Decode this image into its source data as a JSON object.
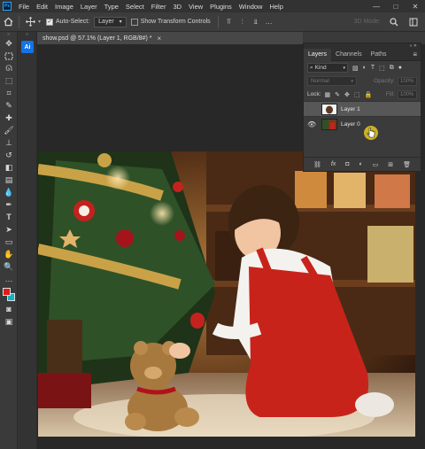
{
  "menubar": {
    "app_badge": "Ps",
    "items": [
      "File",
      "Edit",
      "Image",
      "Layer",
      "Type",
      "Select",
      "Filter",
      "3D",
      "View",
      "Plugins",
      "Window",
      "Help"
    ],
    "window_controls": [
      "—",
      "□",
      "✕"
    ]
  },
  "options": {
    "home_icon": "home-icon",
    "move_icon": "move-tool-icon",
    "auto_select_label": "Auto-Select:",
    "auto_select_checked": true,
    "auto_select_target": "Layer",
    "transform_controls_label": "Show Transform Controls",
    "mode_3d_label": "3D Mode:"
  },
  "document": {
    "tab_title": "show.psd @ 57.1% (Layer 1, RGB/8#) *",
    "close_label": "×"
  },
  "ai_badge": "Ai",
  "layers_panel": {
    "tabs": [
      "Layers",
      "Channels",
      "Paths"
    ],
    "active_tab": "Layers",
    "kind_label": "Kind",
    "blend_mode": "Normal",
    "opacity_label": "Opacity:",
    "opacity_value": "100%",
    "lock_label": "Lock:",
    "fill_label": "Fill:",
    "fill_value": "100%",
    "layers": [
      {
        "name": "Layer 1",
        "visible": false,
        "selected": true
      },
      {
        "name": "Layer 0",
        "visible": true,
        "selected": false
      }
    ]
  },
  "colors": {
    "foreground": "#e31a1a",
    "background": "#18b1c0",
    "accent": "#1473e6"
  }
}
